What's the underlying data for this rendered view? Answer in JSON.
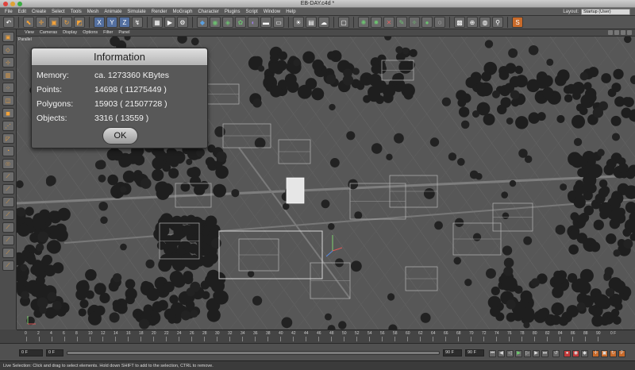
{
  "window": {
    "title": "EB-DAY.c4d *"
  },
  "menubar": {
    "items": [
      "File",
      "Edit",
      "Create",
      "Select",
      "Tools",
      "Mesh",
      "Animate",
      "Simulate",
      "Render",
      "MoGraph",
      "Character",
      "Plugins",
      "Script",
      "Window",
      "Help"
    ],
    "layout_label": "Layout:",
    "layout_value": "Startup (User)"
  },
  "viewport_menu": {
    "items": [
      "View",
      "Cameras",
      "Display",
      "Options",
      "Filter",
      "Panel"
    ]
  },
  "viewport": {
    "label": "Parallel"
  },
  "dialog": {
    "title": "Information",
    "rows": [
      {
        "label": "Memory:",
        "value": "ca. 1273360 KBytes"
      },
      {
        "label": "Points:",
        "value": "14698 ( 11275449 )"
      },
      {
        "label": "Polygons:",
        "value": "15903 ( 21507728 )"
      },
      {
        "label": "Objects:",
        "value": "3316 ( 13559 )"
      }
    ],
    "ok_label": "OK"
  },
  "timeline": {
    "frames": [
      "0",
      "2",
      "4",
      "6",
      "8",
      "10",
      "12",
      "14",
      "16",
      "18",
      "20",
      "22",
      "24",
      "26",
      "28",
      "30",
      "32",
      "34",
      "36",
      "38",
      "40",
      "42",
      "44",
      "46",
      "48",
      "50",
      "52",
      "54",
      "56",
      "58",
      "60",
      "62",
      "64",
      "66",
      "68",
      "70",
      "72",
      "74",
      "76",
      "78",
      "80",
      "82",
      "84",
      "86",
      "88",
      "90"
    ],
    "end_label": "0 F"
  },
  "transport": {
    "start_field": "0 F",
    "current_field": "0 F",
    "end_field": "90 F",
    "max_field": "90 F"
  },
  "status": {
    "text": "Live Selection: Click and drag to select elements. Hold down SHIFT to add to the selection, CTRL to remove."
  }
}
